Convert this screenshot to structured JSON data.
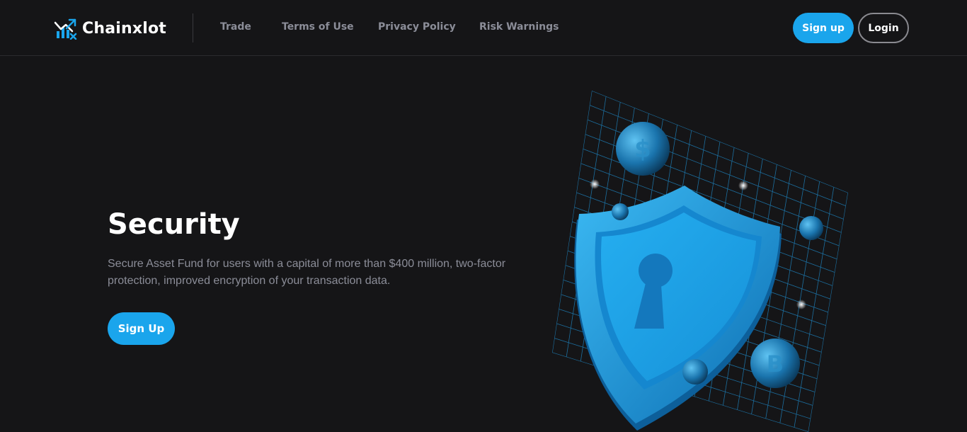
{
  "header": {
    "brand": "Chainxlot",
    "nav": [
      {
        "label": "Trade"
      },
      {
        "label": "Terms of Use"
      },
      {
        "label": "Privacy Policy"
      },
      {
        "label": "Risk Warnings"
      }
    ],
    "signup_label": "Sign up",
    "login_label": "Login"
  },
  "hero": {
    "title": "Security",
    "description": "Secure Asset Fund for users with a capital of more than $400 million, two-factor protection, improved encryption of your transaction data.",
    "cta_label": "Sign Up"
  },
  "colors": {
    "background": "#151517",
    "accent": "#1aa5ec",
    "muted_text": "#8b8d98"
  },
  "icons": {
    "logo": "chart-trend-icon",
    "illustration": "security-shield-lock-icon"
  }
}
